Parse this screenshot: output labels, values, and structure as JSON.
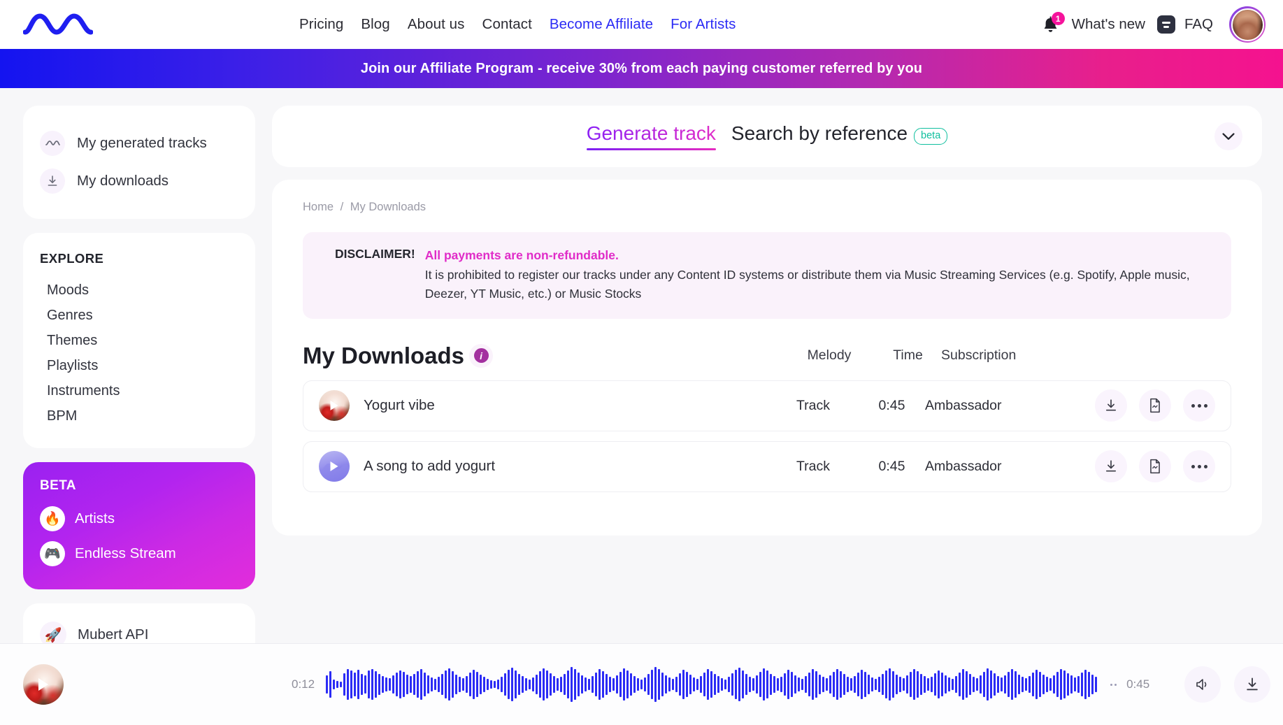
{
  "header": {
    "logo_alt": "mubert-wave-logo",
    "nav": [
      {
        "label": "Pricing",
        "blue": false
      },
      {
        "label": "Blog",
        "blue": false
      },
      {
        "label": "About us",
        "blue": false
      },
      {
        "label": "Contact",
        "blue": false
      },
      {
        "label": "Become Affiliate",
        "blue": true
      },
      {
        "label": "For Artists",
        "blue": true
      }
    ],
    "whats_new": "What's new",
    "notification_count": "1",
    "faq": "FAQ"
  },
  "affiliate_banner": {
    "text": "Join our Affiliate Program - receive 30% from each paying customer referred by you",
    "gradient_from": "#1414f0",
    "gradient_to": "#f5128f"
  },
  "sidebar": {
    "primary": [
      {
        "label": "My generated tracks",
        "icon": "wave-icon"
      },
      {
        "label": "My downloads",
        "icon": "download-icon"
      }
    ],
    "explore_title": "EXPLORE",
    "explore": [
      {
        "label": "Moods"
      },
      {
        "label": "Genres"
      },
      {
        "label": "Themes"
      },
      {
        "label": "Playlists"
      },
      {
        "label": "Instruments"
      },
      {
        "label": "BPM"
      }
    ],
    "beta_title": "BETA",
    "beta": [
      {
        "label": "Artists",
        "emoji": "🔥"
      },
      {
        "label": "Endless Stream",
        "emoji": "🎮"
      }
    ],
    "api": {
      "label": "Mubert API",
      "emoji": "🚀"
    }
  },
  "tabs": {
    "items": [
      {
        "label": "Generate track",
        "active": true,
        "badge": null
      },
      {
        "label": "Search by reference",
        "active": false,
        "badge": "beta"
      }
    ],
    "collapse_icon": "chevron-down-icon"
  },
  "content": {
    "breadcrumb": {
      "home": "Home",
      "separator": "/",
      "current": "My Downloads"
    },
    "disclaimer": {
      "label": "DISCLAIMER!",
      "strong": "All payments are non-refundable.",
      "body": "It is prohibited to register our tracks under any Content ID systems or distribute them via Music Streaming Services (e.g. Spotify, Apple music, Deezer, YT Music, etc.) or Music Stocks"
    },
    "title": "My Downloads",
    "info_badge": "i",
    "columns": {
      "melody": "Melody",
      "time": "Time",
      "subscription": "Subscription"
    },
    "rows": [
      {
        "name": "Yogurt vibe",
        "thumb": "food-photo-thumbnail",
        "melody": "Track",
        "time": "0:45",
        "subscription": "Ambassador",
        "actions": [
          "download-icon",
          "document-wave-icon",
          "more-options-icon"
        ]
      },
      {
        "name": "A song to add yogurt",
        "thumb": "wave-gradient-thumbnail",
        "melody": "Track",
        "time": "0:45",
        "subscription": "Ambassador",
        "actions": [
          "download-icon",
          "document-wave-icon",
          "more-options-icon"
        ]
      }
    ]
  },
  "player": {
    "thumb": "food-photo-thumbnail",
    "current_time": "0:12",
    "total_time": "0:45",
    "waveform_color": "#2b2bf5",
    "waveform": [
      26,
      38,
      14,
      10,
      8,
      32,
      44,
      40,
      34,
      42,
      30,
      26,
      40,
      44,
      38,
      30,
      24,
      20,
      18,
      26,
      34,
      40,
      36,
      28,
      24,
      30,
      38,
      44,
      34,
      26,
      20,
      16,
      22,
      30,
      40,
      46,
      38,
      28,
      22,
      18,
      24,
      34,
      42,
      36,
      28,
      22,
      16,
      12,
      10,
      14,
      22,
      32,
      42,
      48,
      40,
      30,
      24,
      18,
      14,
      20,
      28,
      38,
      46,
      40,
      32,
      24,
      18,
      22,
      30,
      40,
      50,
      44,
      34,
      26,
      20,
      16,
      24,
      34,
      44,
      38,
      30,
      22,
      18,
      26,
      36,
      46,
      40,
      32,
      24,
      18,
      14,
      20,
      30,
      42,
      50,
      44,
      34,
      26,
      20,
      16,
      22,
      32,
      42,
      36,
      28,
      20,
      16,
      24,
      34,
      44,
      38,
      30,
      24,
      18,
      14,
      22,
      32,
      42,
      48,
      40,
      30,
      22,
      18,
      26,
      36,
      46,
      40,
      30,
      24,
      18,
      22,
      32,
      42,
      36,
      26,
      20,
      16,
      24,
      34,
      44,
      38,
      28,
      22,
      18,
      26,
      36,
      44,
      38,
      30,
      22,
      18,
      24,
      34,
      42,
      36,
      28,
      20,
      16,
      22,
      30,
      40,
      46,
      38,
      28,
      22,
      18,
      26,
      36,
      44,
      38,
      30,
      24,
      18,
      22,
      32,
      40,
      34,
      26,
      20,
      16,
      24,
      34,
      44,
      38,
      30,
      22,
      18,
      26,
      36,
      46,
      40,
      32,
      24,
      20,
      26,
      36,
      44,
      38,
      28,
      22,
      18,
      24,
      34,
      42,
      36,
      28,
      22,
      18,
      26,
      36,
      44,
      40,
      32,
      26,
      20,
      24,
      34,
      42,
      36,
      28,
      22
    ],
    "buttons": [
      "volume-icon",
      "download-icon",
      "close-icon"
    ]
  }
}
